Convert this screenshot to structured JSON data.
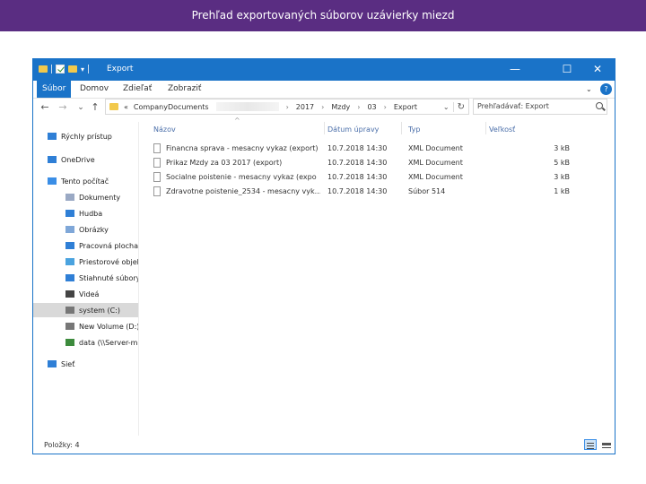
{
  "page_header": "Prehľad exportovaných súborov uzávierky miezd",
  "window": {
    "title": "Export",
    "controls": [
      "—",
      "☐",
      "✕"
    ]
  },
  "ribbon": {
    "tabs": [
      "Súbor",
      "Domov",
      "Zdieľať",
      "Zobraziť"
    ],
    "help": "?"
  },
  "nav_buttons": [
    "←",
    "→",
    "⌄",
    "↑"
  ],
  "address": {
    "chevron": "«",
    "segments": [
      "CompanyDocuments",
      "2017",
      "Mzdy",
      "03",
      "Export"
    ]
  },
  "search": {
    "placeholder": "Prehľadávať: Export"
  },
  "nav_pane": {
    "items": [
      {
        "label": "Rýchly prístup",
        "icon": "star-icon",
        "color": "#2f7fd6"
      },
      {
        "label": "OneDrive",
        "icon": "cloud-icon",
        "color": "#2f7fd6"
      },
      {
        "label": "Tento počítač",
        "icon": "computer-icon",
        "color": "#3a8ee6"
      },
      {
        "label": "Dokumenty",
        "icon": "documents-icon",
        "color": "#9aa9c4"
      },
      {
        "label": "Hudba",
        "icon": "music-icon",
        "color": "#2f7fd6"
      },
      {
        "label": "Obrázky",
        "icon": "pictures-icon",
        "color": "#7fa7d8"
      },
      {
        "label": "Pracovná plocha",
        "icon": "desktop-icon",
        "color": "#2f7fd6"
      },
      {
        "label": "Priestorové objekty",
        "icon": "3d-objects-icon",
        "color": "#4aa3df"
      },
      {
        "label": "Stiahnuté súbory",
        "icon": "downloads-icon",
        "color": "#2f7fd6"
      },
      {
        "label": "Videá",
        "icon": "videos-icon",
        "color": "#444444"
      },
      {
        "label": "system (C:)",
        "icon": "drive-icon",
        "color": "#777777"
      },
      {
        "label": "New Volume (D:)",
        "icon": "drive-icon",
        "color": "#777777"
      },
      {
        "label": "data (\\\\Server-micro",
        "icon": "network-drive-icon",
        "color": "#3d8b3d"
      },
      {
        "label": "Sieť",
        "icon": "network-icon",
        "color": "#2f7fd6"
      }
    ]
  },
  "columns": [
    "Názov",
    "Dátum úpravy",
    "Typ",
    "Veľkosť"
  ],
  "files": [
    {
      "name": "Financna sprava - mesacny vykaz (export)",
      "date": "10.7.2018 14:30",
      "type": "XML Document",
      "size": "3 kB"
    },
    {
      "name": "Prikaz Mzdy za 03 2017 (export)",
      "date": "10.7.2018 14:30",
      "type": "XML Document",
      "size": "5 kB"
    },
    {
      "name": "Socialne poistenie - mesacny vykaz (expo",
      "date": "10.7.2018 14:30",
      "type": "XML Document",
      "size": "3 kB"
    },
    {
      "name": "Zdravotne poistenie_2534 - mesacny vyk...",
      "date": "10.7.2018 14:30",
      "type": "Súbor 514",
      "size": "1 kB"
    }
  ],
  "status": "Položky: 4"
}
